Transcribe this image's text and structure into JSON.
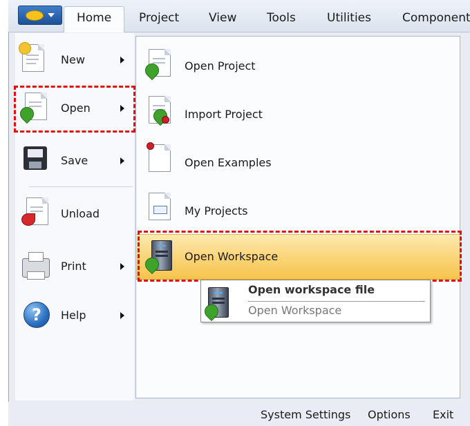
{
  "ribbon": {
    "app_button_icon": "app-logo-icon",
    "tabs": [
      {
        "label": "Home",
        "active": true
      },
      {
        "label": "Project"
      },
      {
        "label": "View"
      },
      {
        "label": "Tools"
      },
      {
        "label": "Utilities"
      },
      {
        "label": "Components"
      }
    ]
  },
  "menu": {
    "items": [
      {
        "label": "New",
        "icon": "new-document-icon",
        "has_submenu": true
      },
      {
        "label": "Open",
        "icon": "open-document-icon",
        "has_submenu": true,
        "highlighted": true
      },
      {
        "label": "Save",
        "icon": "floppy-disk-icon",
        "has_submenu": true
      },
      {
        "label": "Unload",
        "icon": "unload-document-icon",
        "has_submenu": false
      },
      {
        "label": "Print",
        "icon": "printer-icon",
        "has_submenu": true
      },
      {
        "label": "Help",
        "icon": "help-icon",
        "has_submenu": true
      }
    ]
  },
  "submenu": {
    "items": [
      {
        "label": "Open Project",
        "icon": "open-project-icon"
      },
      {
        "label": "Import Project",
        "icon": "import-project-icon"
      },
      {
        "label": "Open Examples",
        "icon": "open-examples-icon"
      },
      {
        "label": "My Projects",
        "icon": "my-projects-icon"
      },
      {
        "label": "Open Workspace",
        "icon": "server-icon",
        "hovered": true
      }
    ]
  },
  "tooltip": {
    "title": "Open workspace file",
    "description": "Open Workspace",
    "icon": "server-icon"
  },
  "footer": {
    "system_settings": "System Settings",
    "options": "Options",
    "exit": "Exit"
  },
  "colors": {
    "highlight_border": "#e01010",
    "hover_gradient_top": "#fdeab0",
    "hover_gradient_bottom": "#f6c44d",
    "ribbon_background": "#dbe3ee"
  }
}
